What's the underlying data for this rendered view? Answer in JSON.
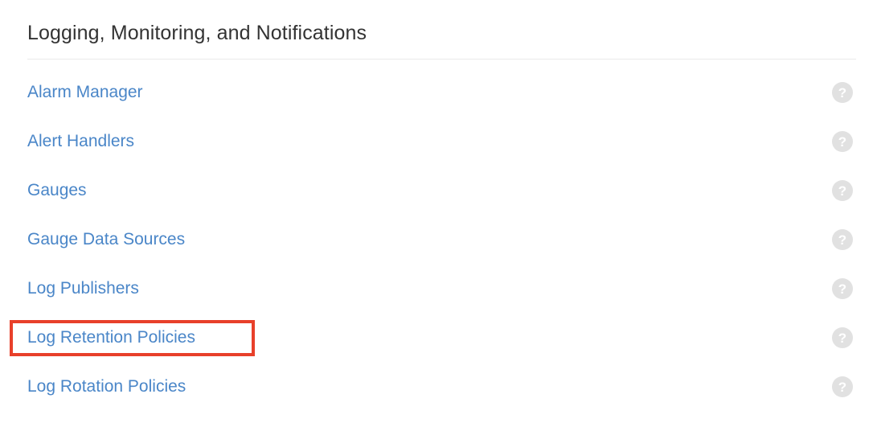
{
  "header": {
    "title": "Logging, Monitoring, and Notifications"
  },
  "colors": {
    "link": "#4a86c8",
    "title": "#333333",
    "divider": "#e9e9e9",
    "help_icon_bg": "#e1e1e1",
    "highlight_border": "#e8402a",
    "background": "#ffffff"
  },
  "list": {
    "help_icon_name": "help-icon",
    "help_icon_glyph": "?",
    "items": [
      {
        "label": "Alarm Manager"
      },
      {
        "label": "Alert Handlers"
      },
      {
        "label": "Gauges"
      },
      {
        "label": "Gauge Data Sources"
      },
      {
        "label": "Log Publishers"
      },
      {
        "label": "Log Retention Policies"
      },
      {
        "label": "Log Rotation Policies"
      }
    ]
  },
  "annotation": {
    "highlighted_item": "Log Retention Policies"
  }
}
